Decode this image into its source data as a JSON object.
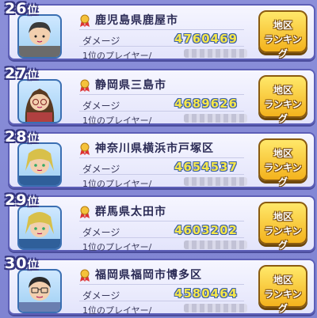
{
  "rows": [
    {
      "rank": "26",
      "rank_suffix": "位",
      "city": "鹿児島県鹿屋市",
      "damage_label": "ダメージ",
      "damage": "4760469",
      "top_player_label": "1位のプレイヤー/",
      "button_line1": "地区",
      "button_line2": "ランキング",
      "avatar": "man-short-hair"
    },
    {
      "rank": "27",
      "rank_suffix": "位",
      "city": "静岡県三島市",
      "damage_label": "ダメージ",
      "damage": "4689626",
      "top_player_label": "1位のプレイヤー/",
      "button_line1": "地区",
      "button_line2": "ランキング",
      "avatar": "woman-glasses"
    },
    {
      "rank": "28",
      "rank_suffix": "位",
      "city": "神奈川県横浜市戸塚区",
      "damage_label": "ダメージ",
      "damage": "4654537",
      "top_player_label": "1位のプレイヤー/",
      "button_line1": "地区",
      "button_line2": "ランキング",
      "avatar": "blonde-boy"
    },
    {
      "rank": "29",
      "rank_suffix": "位",
      "city": "群馬県太田市",
      "damage_label": "ダメージ",
      "damage": "4603202",
      "top_player_label": "1位のプレイヤー/",
      "button_line1": "地区",
      "button_line2": "ランキング",
      "avatar": "blonde-boy"
    },
    {
      "rank": "30",
      "rank_suffix": "位",
      "city": "福岡県福岡市博多区",
      "damage_label": "ダメージ",
      "damage": "4580464",
      "top_player_label": "1位のプレイヤー/",
      "button_line1": "地区",
      "button_line2": "ランキング",
      "avatar": "man-glasses"
    }
  ],
  "colors": {
    "background": "#8b8fd9",
    "card": "#f0f0ff",
    "damage_value": "#f5e64a",
    "button": "#f7c52c"
  }
}
